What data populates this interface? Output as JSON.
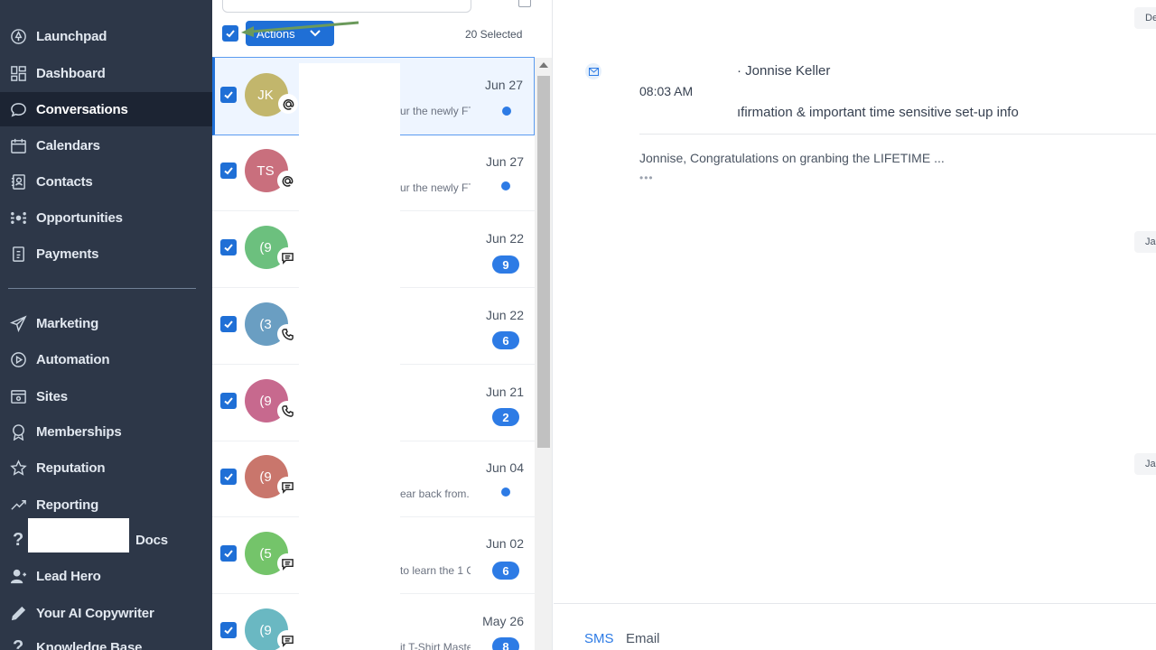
{
  "sidebar": {
    "items": [
      {
        "label": "Launchpad",
        "icon": "rocket-icon"
      },
      {
        "label": "Dashboard",
        "icon": "grid-icon"
      },
      {
        "label": "Conversations",
        "icon": "chat-bubble-icon",
        "active": true
      },
      {
        "label": "Calendars",
        "icon": "calendar-icon"
      },
      {
        "label": "Contacts",
        "icon": "contact-card-icon"
      },
      {
        "label": "Opportunities",
        "icon": "network-icon"
      },
      {
        "label": "Payments",
        "icon": "receipt-icon"
      },
      {
        "label": "Marketing",
        "icon": "paper-plane-icon"
      },
      {
        "label": "Automation",
        "icon": "play-circle-icon"
      },
      {
        "label": "Sites",
        "icon": "browser-icon"
      },
      {
        "label": "Memberships",
        "icon": "award-icon"
      },
      {
        "label": "Reputation",
        "icon": "star-icon"
      },
      {
        "label": "Reporting",
        "icon": "trend-icon"
      },
      {
        "label": "Docs",
        "icon": "question-icon"
      },
      {
        "label": "Lead Hero",
        "icon": "user-plus-icon"
      },
      {
        "label": "Your AI Copywriter",
        "icon": "pencil-icon"
      },
      {
        "label": "Knowledge Base",
        "icon": "question-icon"
      }
    ]
  },
  "list": {
    "actions_label": "Actions",
    "selected_count": "20 Selected",
    "rows": [
      {
        "initials": "JK",
        "color": "#c2b66c",
        "channel": "at-icon",
        "date": "Jun 27",
        "snippet": "ur the newly FT",
        "unread": "dot"
      },
      {
        "initials": "TS",
        "color": "#c96f7d",
        "channel": "at-icon",
        "date": "Jun 27",
        "snippet": "ur the newly FT",
        "unread": "dot"
      },
      {
        "initials": "(9",
        "color": "#6cc07e",
        "channel": "sms-icon",
        "date": "Jun 22",
        "snippet": "",
        "count": "9"
      },
      {
        "initials": "(3",
        "color": "#6a9ec2",
        "channel": "phone-icon",
        "date": "Jun 22",
        "snippet": "",
        "count": "6"
      },
      {
        "initials": "(9",
        "color": "#c7698e",
        "channel": "phone-icon",
        "date": "Jun 21",
        "snippet": "",
        "count": "2"
      },
      {
        "initials": "(9",
        "color": "#c9766c",
        "channel": "sms-icon",
        "date": "Jun 04",
        "snippet": "ear back from.",
        "unread": "dot"
      },
      {
        "initials": "(5",
        "color": "#74c46a",
        "channel": "sms-icon",
        "date": "Jun 02",
        "snippet": "to learn the 1 C",
        "count": "6"
      },
      {
        "initials": "(9",
        "color": "#6ab8c2",
        "channel": "sms-icon",
        "date": "May 26",
        "snippet": "it T-Shirt Maste",
        "count": "8"
      }
    ]
  },
  "detail": {
    "from": "· Jonnise Keller",
    "time": "08:03 AM",
    "subject": "ıfirmation & important time sensitive set-up info",
    "body": "Jonnise, Congratulations on granbing the LIFETIME ...",
    "more": "•••",
    "date_pills": [
      "De",
      "Ja",
      "Ja"
    ],
    "tabs": [
      "SMS",
      "Email"
    ]
  },
  "colors": {
    "sidebar_bg": "#2d3748",
    "accent": "#1f6fd6",
    "badge": "#2d7be5"
  }
}
